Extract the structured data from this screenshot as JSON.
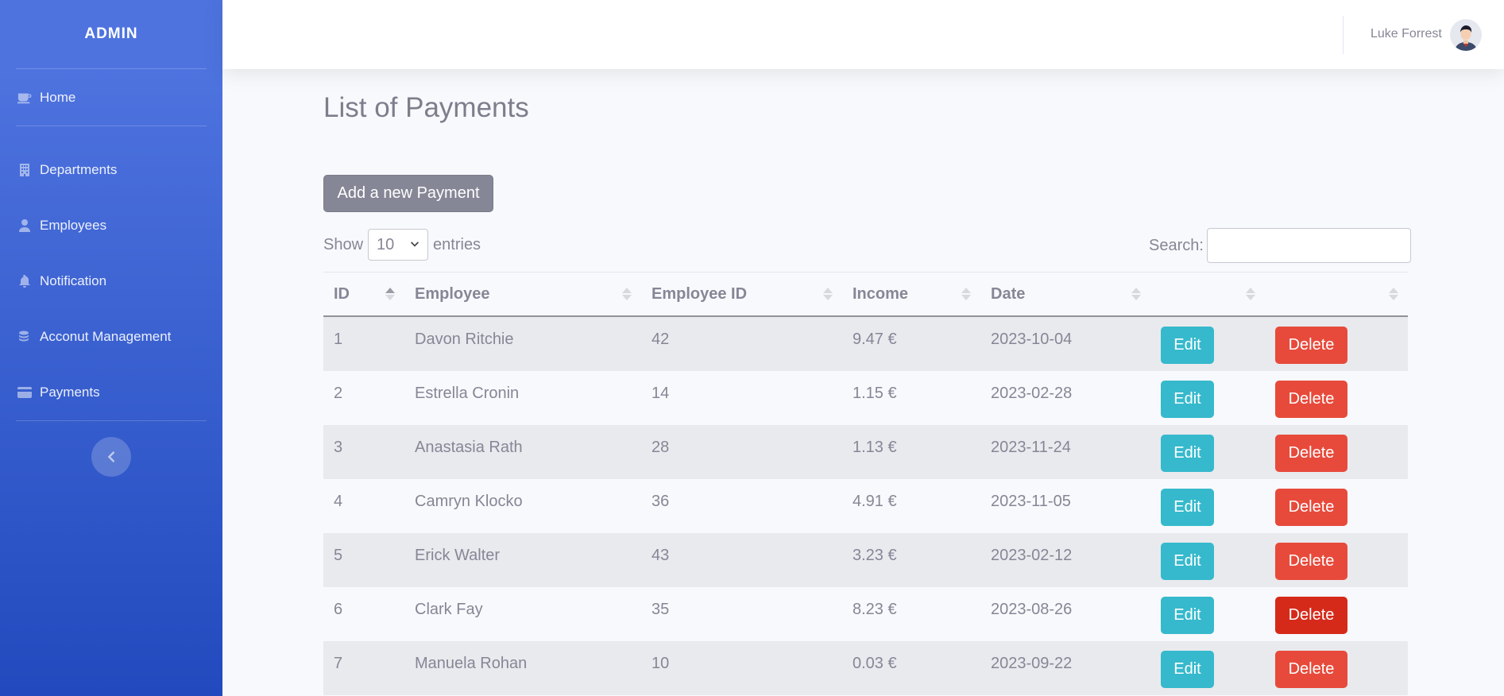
{
  "sidebar": {
    "brand": "ADMIN",
    "items": [
      {
        "label": "Home",
        "icon": "coffee-icon"
      },
      {
        "label": "Departments",
        "icon": "building-icon"
      },
      {
        "label": "Employees",
        "icon": "user-icon"
      },
      {
        "label": "Notification",
        "icon": "bell-icon"
      },
      {
        "label": "Acconut Management",
        "icon": "coins-icon"
      },
      {
        "label": "Payments",
        "icon": "credit-card-icon"
      }
    ],
    "toggle_icon": "chevron-left-icon"
  },
  "topbar": {
    "user_name": "Luke Forrest"
  },
  "page": {
    "title": "List of Payments",
    "add_button": "Add a new Payment",
    "show_label": "Show",
    "entries_value": "10",
    "entries_label": "entries",
    "search_label": "Search:",
    "search_value": ""
  },
  "table": {
    "headers": [
      "ID",
      "Employee",
      "Employee ID",
      "Income",
      "Date",
      "",
      ""
    ],
    "sorted_column": "ID",
    "edit_label": "Edit",
    "delete_label": "Delete",
    "rows": [
      {
        "id": "1",
        "employee": "Davon Ritchie",
        "employee_id": "42",
        "income": "9.47 €",
        "date": "2023-10-04"
      },
      {
        "id": "2",
        "employee": "Estrella Cronin",
        "employee_id": "14",
        "income": "1.15 €",
        "date": "2023-02-28"
      },
      {
        "id": "3",
        "employee": "Anastasia Rath",
        "employee_id": "28",
        "income": "1.13 €",
        "date": "2023-11-24"
      },
      {
        "id": "4",
        "employee": "Camryn Klocko",
        "employee_id": "36",
        "income": "4.91 €",
        "date": "2023-11-05"
      },
      {
        "id": "5",
        "employee": "Erick Walter",
        "employee_id": "43",
        "income": "3.23 €",
        "date": "2023-02-12"
      },
      {
        "id": "6",
        "employee": "Clark Fay",
        "employee_id": "35",
        "income": "8.23 €",
        "date": "2023-08-26"
      },
      {
        "id": "7",
        "employee": "Manuela Rohan",
        "employee_id": "10",
        "income": "0.03 €",
        "date": "2023-09-22"
      }
    ]
  },
  "colors": {
    "sidebar_top": "#4e73df",
    "sidebar_bottom": "#224abe",
    "edit": "#36b9cc",
    "delete": "#e74a3b",
    "add_button": "#858796"
  }
}
